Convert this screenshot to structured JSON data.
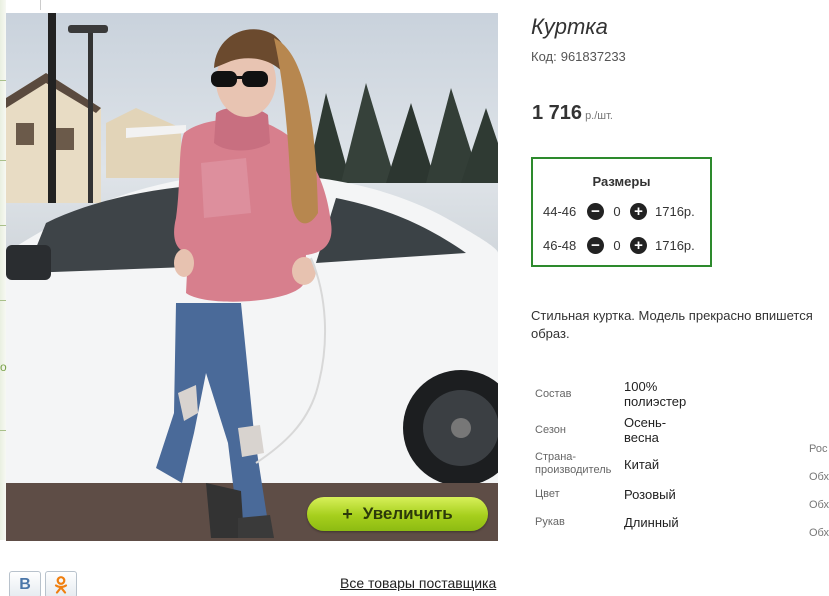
{
  "product": {
    "title": "Куртка",
    "code_label": "Код:",
    "code_value": "961837233",
    "price": "1 716",
    "price_unit": "р./шт."
  },
  "sizes": {
    "title": "Размеры",
    "rows": [
      {
        "size": "44-46",
        "qty": "0",
        "price": "1716р."
      },
      {
        "size": "46-48",
        "qty": "0",
        "price": "1716р."
      }
    ]
  },
  "description": {
    "line1": "Стильная куртка. Модель прекрасно впишется",
    "line2": "образ."
  },
  "specs": [
    {
      "label": "Состав",
      "value_l1": "100%",
      "value_l2": "полиэстер"
    },
    {
      "label": "Сезон",
      "value_l1": "Осень-",
      "value_l2": "весна"
    },
    {
      "label_l1": "Страна-",
      "label_l2": "производитель",
      "value_l1": "Китай"
    },
    {
      "label": "Цвет",
      "value_l1": "Розовый"
    },
    {
      "label": "Рукав",
      "value_l1": "Длинный"
    }
  ],
  "cut_labels": [
    "Рос",
    "Обх",
    "Обх",
    "Обх"
  ],
  "zoom_button": {
    "label": "Увеличить",
    "icon": "plus-icon"
  },
  "social": {
    "vk_label": "В",
    "ok_icon": "odnoklassniki-icon"
  },
  "supplier_link": "Все товары поставщика",
  "colors": {
    "accent_green": "#2d8a2d",
    "button_green": "#a6cf1c"
  }
}
